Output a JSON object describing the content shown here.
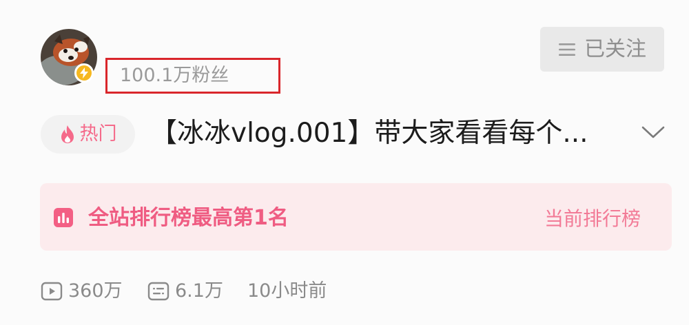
{
  "header": {
    "fans_text": "100.1万粉丝",
    "follow_label": "已关注"
  },
  "video": {
    "hot_label": "热门",
    "title": "【冰冰vlog.001】带大家看看每个..."
  },
  "ranking": {
    "title": "全站排行榜最高第1名",
    "link_label": "当前排行榜"
  },
  "stats": {
    "plays": "360万",
    "danmaku": "6.1万",
    "time_ago": "10小时前"
  },
  "colors": {
    "accent_pink": "#ef5c82",
    "highlight_red": "#d9262b",
    "verified_gold": "#f6b820"
  }
}
